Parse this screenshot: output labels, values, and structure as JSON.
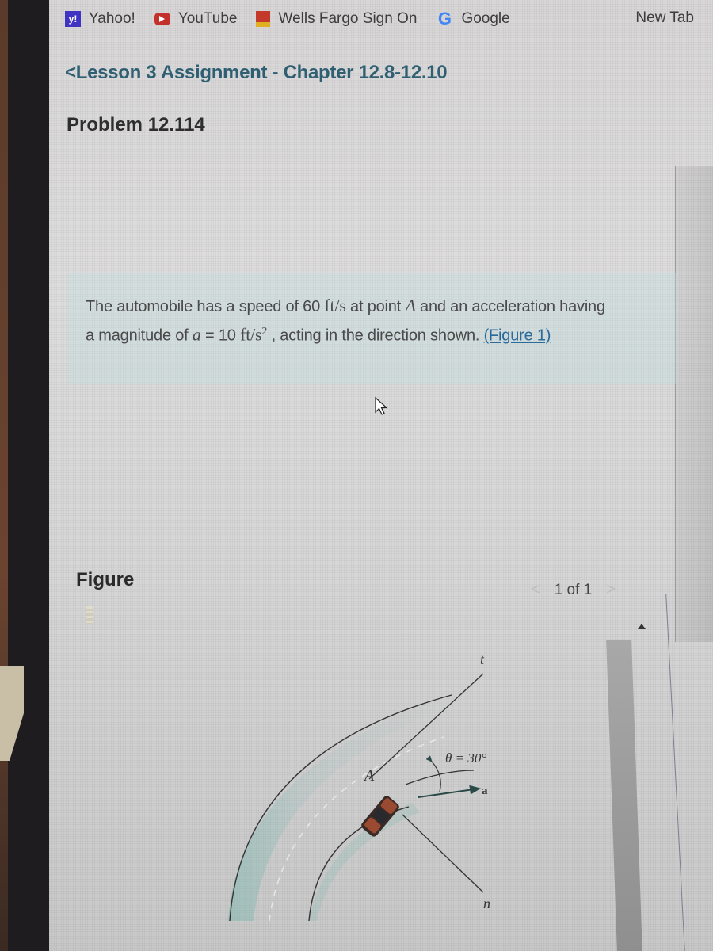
{
  "bookmarks_bar": {
    "items": [
      {
        "label": "Yahoo!",
        "icon": "yahoo-icon",
        "icon_glyph": "y!",
        "color": "#3f33c4"
      },
      {
        "label": "YouTube",
        "icon": "youtube-icon",
        "color": "#c4302b"
      },
      {
        "label": "Wells Fargo Sign On",
        "icon": "wells-fargo-icon",
        "color": "#c33a2a"
      },
      {
        "label": "Google",
        "icon": "google-icon",
        "icon_glyph": "G",
        "color": "#4285f4"
      }
    ],
    "new_tab_label": "New Tab"
  },
  "breadcrumb": {
    "back_glyph": "<",
    "label": "Lesson 3 Assignment - Chapter 12.8-12.10"
  },
  "problem": {
    "title": "Problem 12.114",
    "text_part1": "The automobile has a speed of 60 ",
    "speed_unit": "ft/s",
    "text_part2": " at point ",
    "point": "A",
    "text_part3": " and an acceleration having a magnitude of ",
    "accel_symbol": "a",
    "accel_eq": " = 10 ",
    "accel_unit": "ft/s",
    "accel_unit_exp": "2",
    "text_part4": " , acting in the direction shown. ",
    "figure_link": "(Figure 1)"
  },
  "figure": {
    "heading": "Figure",
    "pager": {
      "prev": "<",
      "text": "1 of 1",
      "next": ">"
    },
    "labels": {
      "point": "A",
      "tangent_axis": "t",
      "normal_axis": "n",
      "angle": "θ = 30°",
      "accel_vector": "a"
    },
    "road_color": "#7fb7b0"
  }
}
